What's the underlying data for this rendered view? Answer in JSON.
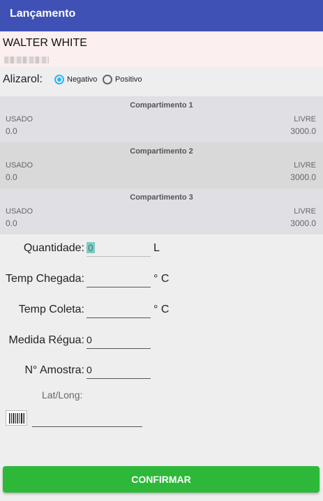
{
  "app": {
    "title": "Lançamento"
  },
  "client": {
    "name": "WALTER WHITE"
  },
  "alizarol": {
    "label": "Alizarol:",
    "options": [
      {
        "label": "Negativo",
        "selected": true
      },
      {
        "label": "Positivo",
        "selected": false
      }
    ]
  },
  "compartments": [
    {
      "title": "Compartimento 1",
      "used_label": "USADO",
      "used": "0.0",
      "free_label": "LIVRE",
      "free": "3000.0"
    },
    {
      "title": "Compartimento 2",
      "used_label": "USADO",
      "used": "0.0",
      "free_label": "LIVRE",
      "free": "3000.0"
    },
    {
      "title": "Compartimento 3",
      "used_label": "USADO",
      "used": "0.0",
      "free_label": "LIVRE",
      "free": "3000.0"
    }
  ],
  "form": {
    "quantidade": {
      "label": "Quantidade:",
      "value": "0",
      "unit": "L"
    },
    "temp_chegada": {
      "label": "Temp Chegada:",
      "value": "",
      "unit": "° C"
    },
    "temp_coleta": {
      "label": "Temp Coleta:",
      "value": "",
      "unit": "° C"
    },
    "medida_regua": {
      "label": "Medida Régua:",
      "value": "0"
    },
    "amostra": {
      "label": "N° Amostra:",
      "value": "0"
    },
    "latlong": {
      "label": "Lat/Long:"
    },
    "barcode_value": ""
  },
  "actions": {
    "confirm_label": "CONFIRMAR"
  },
  "colors": {
    "appbar": "#3f51b5",
    "accent": "#29b6f6",
    "confirm": "#2eb83a"
  }
}
